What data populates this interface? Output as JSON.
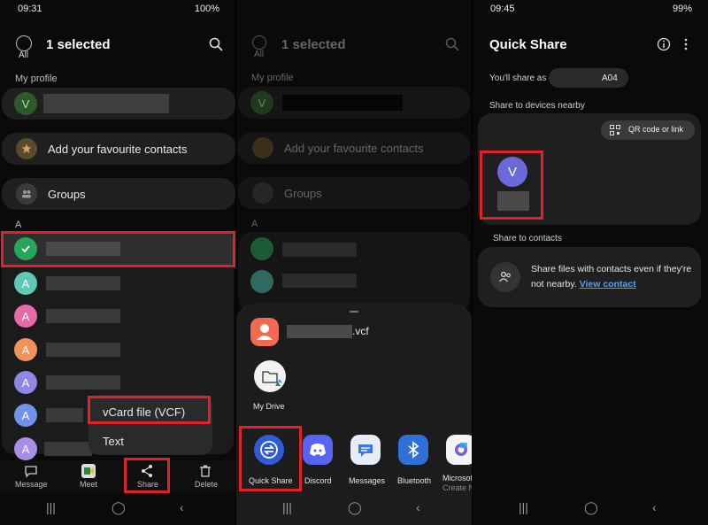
{
  "panel1": {
    "status": {
      "time": "09:31",
      "battery": "100%"
    },
    "all_label": "All",
    "title": "1 selected",
    "section_profile": "My profile",
    "profile_initial": "V",
    "add_favourites": "Add your favourite contacts",
    "groups": "Groups",
    "section_a": "A",
    "contact_initial": "A",
    "popup_items": [
      "vCard file (VCF)",
      "Text"
    ],
    "bottom_actions": [
      "Message",
      "Meet",
      "Share",
      "Delete"
    ]
  },
  "panel2": {
    "all_label": "All",
    "title": "1 selected",
    "section_profile": "My profile",
    "profile_initial": "V",
    "add_favourites": "Add your favourite contacts",
    "groups": "Groups",
    "section_a": "A",
    "file_ext": ".vcf",
    "my_drive": "My Drive",
    "apps": [
      "Quick Share",
      "Discord",
      "Messages",
      "Bluetooth",
      "Microsof",
      "Create N"
    ]
  },
  "panel3": {
    "status": {
      "time": "09:45",
      "battery": "99%"
    },
    "title": "Quick Share",
    "share_as_label": "You'll share as",
    "share_as_value": "A04",
    "nearby_label": "Share to devices nearby",
    "qr_button": "QR code or link",
    "device_initial": "V",
    "contacts_label": "Share to contacts",
    "contacts_text": "Share files with contacts even if they're not nearby.",
    "view_contact": "View contact"
  },
  "icons": [
    "search-icon",
    "info-icon",
    "more-vert-icon",
    "star-icon",
    "groups-icon",
    "check-icon",
    "message-icon",
    "meet-icon",
    "share-icon",
    "delete-icon",
    "qr-icon",
    "people-icon",
    "drive-folder-icon",
    "quick-share-icon",
    "discord-icon",
    "messages-icon",
    "bluetooth-icon",
    "microsoft-icon"
  ],
  "colors": {
    "accent_red": "#e0202a",
    "selected_green": "#26a65b",
    "link_blue": "#4ea1ff",
    "avatar_teal": "#5fc9b8",
    "avatar_pink": "#e56aa8",
    "avatar_orange": "#f0935a",
    "avatar_purple": "#8f86e6",
    "avatar_blue": "#6f93e8"
  }
}
